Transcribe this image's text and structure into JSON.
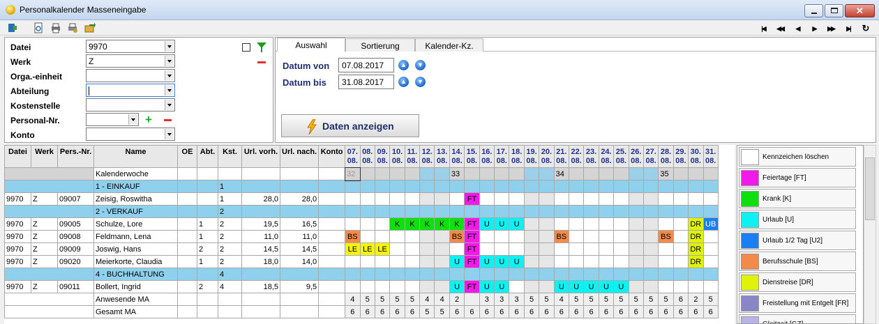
{
  "window": {
    "title": "Personalkalender Masseneingabe"
  },
  "colors": {
    "ft": "#f21ae8",
    "k": "#0ee00e",
    "u": "#0cf2f2",
    "u2": "#1a7ff0",
    "bs": "#f28a4a",
    "dr": "#dff20a",
    "le": "#f5f50a",
    "fr": "#8a84c8",
    "gz": "#b8b4e6"
  },
  "toolbar": {
    "icons": [
      "exit-icon",
      "print-preview-icon",
      "print-icon",
      "print-settings-icon",
      "export-icon"
    ],
    "nav": [
      "first-icon",
      "prev-page-icon",
      "prev-icon",
      "next-icon",
      "next-page-icon",
      "last-icon",
      "refresh-icon"
    ]
  },
  "filters": [
    {
      "label": "Datei",
      "value": "9970"
    },
    {
      "label": "Werk",
      "value": "Z"
    },
    {
      "label": "Orga.-einheit",
      "value": ""
    },
    {
      "label": "Abteilung",
      "value": ""
    },
    {
      "label": "Kostenstelle",
      "value": ""
    },
    {
      "label": "Personal-Nr.",
      "value": ""
    },
    {
      "label": "Konto",
      "value": ""
    }
  ],
  "tabs": [
    "Auswahl",
    "Sortierung",
    "Kalender-Kz."
  ],
  "dates": {
    "von_label": "Datum von",
    "von": "07.08.2017",
    "bis_label": "Datum bis",
    "bis": "31.08.2017"
  },
  "show_button": "Daten anzeigen",
  "table": {
    "headers": [
      "Datei",
      "Werk",
      "Pers.-Nr.",
      "Name",
      "OE",
      "Abt.",
      "Kst.",
      "Url. vorh.",
      "Url. nach.",
      "Konto"
    ],
    "days": [
      "07.",
      "08.",
      "09.",
      "10.",
      "11.",
      "12.",
      "13.",
      "14.",
      "15.",
      "16.",
      "17.",
      "18.",
      "19.",
      "20.",
      "21.",
      "22.",
      "23.",
      "24.",
      "25.",
      "26.",
      "27.",
      "28.",
      "29.",
      "30.",
      "31."
    ],
    "month": "08.",
    "weekend": [
      5,
      6,
      12,
      13,
      19,
      20
    ],
    "kw": {
      "label": "Kalenderwoche",
      "cells": [
        "32",
        "",
        "",
        "",
        "",
        "",
        "",
        "33",
        "",
        "",
        "",
        "",
        "",
        "",
        "34",
        "",
        "",
        "",
        "",
        "",
        "",
        "35",
        "",
        "",
        ""
      ]
    },
    "rows": [
      {
        "type": "group",
        "name": "1 - EINKAUF",
        "kst": "1"
      },
      {
        "type": "emp",
        "datei": "9970",
        "werk": "Z",
        "nr": "09007",
        "name": "Zeisig, Roswitha",
        "oe": "",
        "abt": "",
        "kst": "1",
        "vorh": "28,0",
        "nach": "28,0",
        "konto": "",
        "cells": {
          "8": "FT"
        }
      },
      {
        "type": "group",
        "name": "2 - VERKAUF",
        "kst": "2"
      },
      {
        "type": "emp",
        "datei": "9970",
        "werk": "Z",
        "nr": "09005",
        "name": "Schulze, Lore",
        "oe": "",
        "abt": "1",
        "kst": "2",
        "vorh": "19,5",
        "nach": "16,5",
        "konto": "",
        "cells": {
          "3": "K",
          "4": "K",
          "5": "K",
          "6": "K",
          "7": "K",
          "8": "FT",
          "9": "U",
          "10": "U",
          "11": "U",
          "23": "DR",
          "24": "UB"
        }
      },
      {
        "type": "emp",
        "datei": "9970",
        "werk": "Z",
        "nr": "09008",
        "name": "Feldmann, Lena",
        "oe": "",
        "abt": "1",
        "kst": "2",
        "vorh": "11,0",
        "nach": "11,0",
        "konto": "",
        "cells": {
          "0": "BS",
          "7": "BS",
          "8": "FT",
          "14": "BS",
          "21": "BS",
          "23": "DR"
        }
      },
      {
        "type": "emp",
        "datei": "9970",
        "werk": "Z",
        "nr": "09009",
        "name": "Joswig, Hans",
        "oe": "",
        "abt": "2",
        "kst": "2",
        "vorh": "14,5",
        "nach": "14,5",
        "konto": "",
        "cells": {
          "0": "LE",
          "1": "LE",
          "2": "LE",
          "8": "FT",
          "23": "DR"
        }
      },
      {
        "type": "emp",
        "datei": "9970",
        "werk": "Z",
        "nr": "09020",
        "name": "Meierkorte, Claudia",
        "oe": "",
        "abt": "1",
        "kst": "2",
        "vorh": "18,0",
        "nach": "14,0",
        "konto": "",
        "cells": {
          "7": "U",
          "8": "FT",
          "9": "U",
          "10": "U",
          "11": "U",
          "23": "DR"
        }
      },
      {
        "type": "group",
        "name": "4 - BUCHHALTUNG",
        "kst": "4"
      },
      {
        "type": "emp",
        "datei": "9970",
        "werk": "Z",
        "nr": "09011",
        "name": "Bollert, Ingrid",
        "oe": "",
        "abt": "2",
        "kst": "4",
        "vorh": "18,5",
        "nach": "9,5",
        "konto": "",
        "cells": {
          "7": "U",
          "8": "FT",
          "9": "U",
          "10": "U",
          "14": "U",
          "15": "U",
          "16": "U",
          "17": "U",
          "18": "U"
        }
      },
      {
        "type": "sum",
        "name": "Anwesende MA",
        "cells": [
          "4",
          "5",
          "5",
          "5",
          "5",
          "4",
          "4",
          "2",
          "",
          "3",
          "3",
          "3",
          "5",
          "5",
          "4",
          "5",
          "5",
          "5",
          "5",
          "5",
          "5",
          "5",
          "6",
          "2",
          "5"
        ]
      },
      {
        "type": "sum",
        "name": "Gesamt MA",
        "cells": [
          "6",
          "6",
          "6",
          "6",
          "6",
          "5",
          "5",
          "6",
          "6",
          "6",
          "6",
          "6",
          "6",
          "6",
          "6",
          "6",
          "6",
          "6",
          "6",
          "6",
          "6",
          "6",
          "6",
          "6",
          "6"
        ]
      }
    ]
  },
  "legend": [
    {
      "label": "Kennzeichen löschen",
      "color": "#ffffff"
    },
    {
      "label": "Feiertage [FT]",
      "color": "#f21ae8"
    },
    {
      "label": "Krank [K]",
      "color": "#0ee00e"
    },
    {
      "label": "Urlaub [U]",
      "color": "#0cf2f2"
    },
    {
      "label": "Urlaub 1/2 Tag [U2]",
      "color": "#1a7ff0"
    },
    {
      "label": "Berufsschule [BS]",
      "color": "#f28a4a"
    },
    {
      "label": "Dienstreise [DR]",
      "color": "#dff20a"
    },
    {
      "label": "Freistellung mit Entgelt [FR]",
      "color": "#8a84c8"
    },
    {
      "label": "Gleitzeit [GZ]",
      "color": "#b8b4e6"
    }
  ]
}
